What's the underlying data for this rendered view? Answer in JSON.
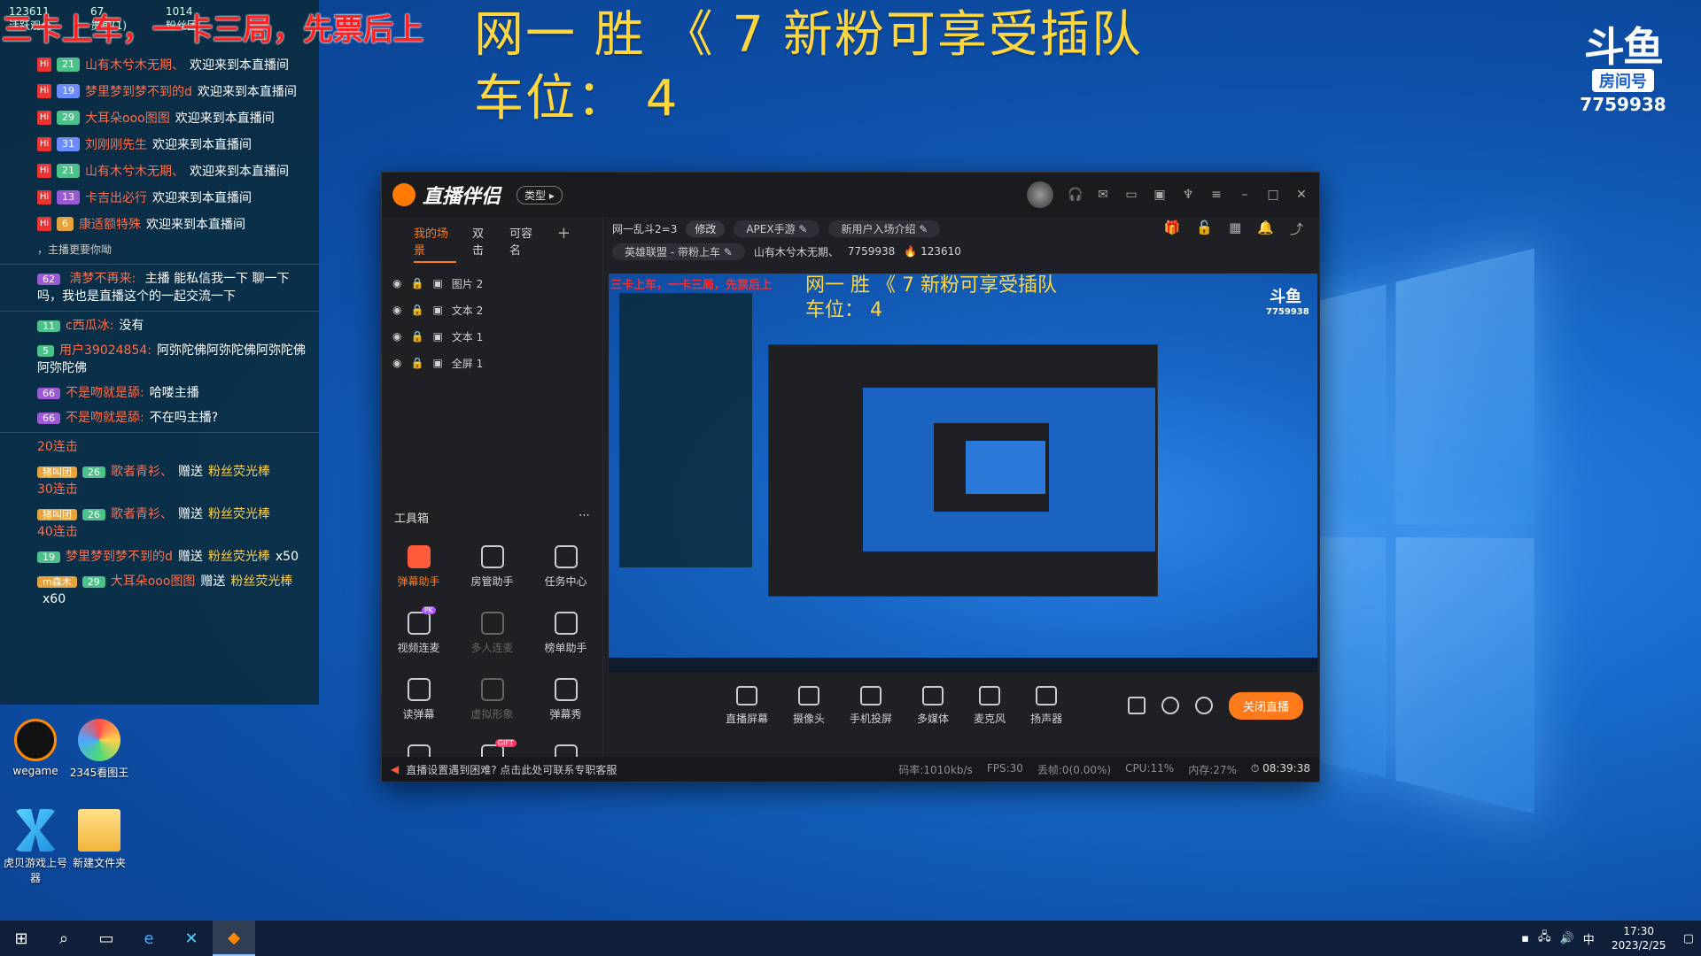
{
  "overlay": {
    "red_banner": "三卡上车，一卡三局，先票后上",
    "title_line1": "网一    胜  《 7   新粉可享受插队",
    "title_line2": "车位：  4"
  },
  "room_badge": {
    "logo": "斗鱼",
    "tag": "房间号",
    "number": "7759938"
  },
  "chat": {
    "header": [
      "活跃观众",
      "贵宾(1)",
      "粉丝团"
    ],
    "header_counts": [
      "123611",
      "67",
      "1014"
    ],
    "welcome": [
      {
        "level": "21",
        "user": "山有木兮木无期、",
        "msg": "欢迎来到本直播间"
      },
      {
        "level": "19",
        "user": "梦里梦到梦不到的d",
        "msg": "欢迎来到本直播间"
      },
      {
        "level": "29",
        "user": "大耳朵ooo图图",
        "msg": "欢迎来到本直播间"
      },
      {
        "level": "31",
        "user": "刘刚刚先生",
        "msg": "欢迎来到本直播间"
      },
      {
        "level": "21",
        "user": "山有木兮木无期、",
        "msg": "欢迎来到本直播间"
      },
      {
        "level": "13",
        "user": "卡吉出必行",
        "msg": "欢迎来到本直播间"
      },
      {
        "level": "6",
        "user": "康适额特殊",
        "msg": "欢迎来到本直播间"
      }
    ],
    "partial": "，主播更要你呦",
    "big_msg": {
      "level": "62",
      "user": "清梦不再来:",
      "msg": "主播 能私信我一下 聊一下吗，我也是直播这个的一起交流一下"
    },
    "messages": [
      {
        "level": "11",
        "user": "c西瓜冰:",
        "msg": "没有"
      },
      {
        "level": "5",
        "user": "用户39024854:",
        "msg": "阿弥陀佛阿弥陀佛阿弥陀佛阿弥陀佛"
      },
      {
        "level": "66",
        "user": "不是吻就是舔:",
        "msg": "哈喽主播"
      },
      {
        "level": "66",
        "user": "不是吻就是舔:",
        "msg": "不在吗主播?"
      }
    ],
    "gifts": [
      {
        "combo": "20连击"
      },
      {
        "fan": "猪叫团",
        "level": "26",
        "user": "歌者青衫、",
        "verb": "赠送",
        "gift": "粉丝荧光棒",
        "combo": "30连击"
      },
      {
        "fan": "猪叫团",
        "level": "26",
        "user": "歌者青衫、",
        "verb": "赠送",
        "gift": "粉丝荧光棒",
        "combo": "40连击"
      },
      {
        "level": "19",
        "user": "梦里梦到梦不到的d",
        "verb": "赠送",
        "gift": "粉丝荧光棒",
        "count": "x50"
      },
      {
        "fan": "m森木",
        "level": "29",
        "user": "大耳朵ooo图图",
        "verb": "赠送",
        "gift": "粉丝荧光棒",
        "count": "x60"
      }
    ]
  },
  "desktop_icons": [
    {
      "label": "wegame"
    },
    {
      "label": "2345看图王"
    },
    {
      "label": "虎贝游戏上号器"
    },
    {
      "label": "新建文件夹"
    }
  ],
  "app": {
    "title": "直播伴侣",
    "type_pill": "类型 ▸",
    "side_tabs": [
      "我的场景",
      "双击",
      "可容名"
    ],
    "scenes": [
      "图片 2",
      "文本 2",
      "文本 1",
      "全屏 1"
    ],
    "toolbox_label": "工具箱",
    "tools": [
      {
        "label": "弹幕助手"
      },
      {
        "label": "房管助手"
      },
      {
        "label": "任务中心"
      },
      {
        "label": "视频连麦",
        "badge": "PK"
      },
      {
        "label": "多人连麦"
      },
      {
        "label": "榜单助手"
      },
      {
        "label": "读弹幕"
      },
      {
        "label": "虚拟形象"
      },
      {
        "label": "弹幕秀"
      },
      {
        "label": ""
      },
      {
        "label": "",
        "badge": "GIFT"
      },
      {
        "label": ""
      }
    ],
    "stream_title": "网一乱斗2=3",
    "edit_label": "修改",
    "tag1": "APEX手游",
    "tag2": "新用户入场介绍",
    "category": "英雄联盟 - 带粉上车",
    "streamer": "山有木兮木无期、",
    "room_id": "7759938",
    "hot": "123610",
    "controls": [
      "直播屏幕",
      "摄像头",
      "手机投屏",
      "多媒体",
      "麦克风",
      "扬声器"
    ],
    "live_button": "关闭直播",
    "status_tip": "直播设置遇到困难? 点击此处可联系专职客服",
    "stats": {
      "bitrate": "码率:1010kb/s",
      "fps": "FPS:30",
      "drop": "丢帧:0(0.00%)",
      "cpu": "CPU:11%",
      "mem": "内存:27%",
      "time": "08:39:38"
    },
    "preview": {
      "red": "三卡上车，一卡三局，先票后上",
      "title1": "网一   胜  《 7   新粉可享受插队",
      "title2": "车位：  4",
      "badge": "7759938"
    }
  },
  "taskbar": {
    "ime": "中",
    "time": "17:30",
    "date": "2023/2/25"
  },
  "colors": {
    "accent": "#ff7a1a",
    "overlay_yellow": "#ffd63d",
    "overlay_red": "#ff2222"
  }
}
